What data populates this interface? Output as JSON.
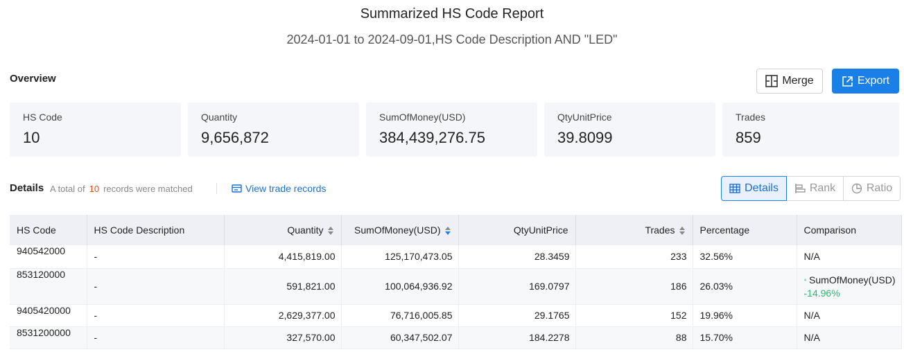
{
  "header": {
    "title": "Summarized HS Code Report",
    "subtitle": "2024-01-01 to 2024-09-01,HS Code Description AND \"LED\""
  },
  "overview": {
    "label": "Overview",
    "merge_label": "Merge",
    "export_label": "Export",
    "cards": [
      {
        "label": "HS Code",
        "value": "10"
      },
      {
        "label": "Quantity",
        "value": "9,656,872"
      },
      {
        "label": "SumOfMoney(USD)",
        "value": "384,439,276.75"
      },
      {
        "label": "QtyUnitPrice",
        "value": "39.8099"
      },
      {
        "label": "Trades",
        "value": "859"
      }
    ]
  },
  "details": {
    "label": "Details",
    "matched_prefix": "A total of",
    "matched_count": "10",
    "matched_suffix": "records were matched",
    "view_link": "View trade records",
    "views": {
      "details": "Details",
      "rank": "Rank",
      "ratio": "Ratio"
    }
  },
  "table": {
    "columns": [
      "HS Code",
      "HS Code Description",
      "Quantity",
      "SumOfMoney(USD)",
      "QtyUnitPrice",
      "Trades",
      "Percentage",
      "Comparison"
    ],
    "rows": [
      {
        "code": "940542000",
        "desc": "-",
        "quantity": "4,415,819.00",
        "money": "125,170,473.05",
        "unit_price": "28.3459",
        "trades": "233",
        "percentage": "32.56%",
        "comparison": "N/A",
        "comparison_pct": ""
      },
      {
        "code": "853120000",
        "desc": "-",
        "quantity": "591,821.00",
        "money": "100,064,936.92",
        "unit_price": "169.0797",
        "trades": "186",
        "percentage": "26.03%",
        "comparison": "SumOfMoney(USD)",
        "comparison_pct": "-14.96%"
      },
      {
        "code": "9405420000",
        "desc": "-",
        "quantity": "2,629,377.00",
        "money": "76,716,005.85",
        "unit_price": "29.1765",
        "trades": "152",
        "percentage": "19.96%",
        "comparison": "N/A",
        "comparison_pct": ""
      },
      {
        "code": "8531200000",
        "desc": "-",
        "quantity": "327,570.00",
        "money": "60,347,502.07",
        "unit_price": "184.2278",
        "trades": "88",
        "percentage": "15.70%",
        "comparison": "N/A",
        "comparison_pct": ""
      }
    ]
  },
  "colors": {
    "accent": "#1a7fe6",
    "matched_count": "#e64a19",
    "positive": "#2eb872"
  }
}
